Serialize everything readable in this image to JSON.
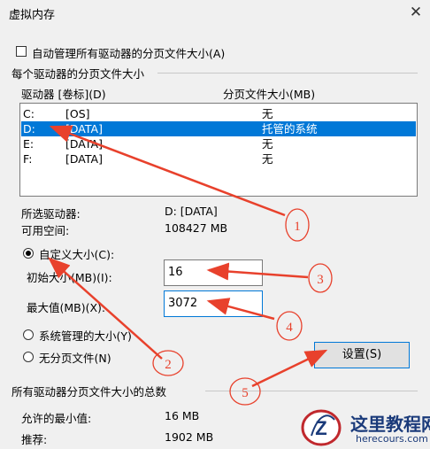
{
  "window": {
    "title": "虚拟内存",
    "close_glyph": "✕"
  },
  "auto_manage": {
    "label": "自动管理所有驱动器的分页文件大小(A)",
    "checked": false
  },
  "per_drive": {
    "group_label": "每个驱动器的分页文件大小",
    "col_drive": "驱动器 [卷标](D)",
    "col_size": "分页文件大小(MB)",
    "drives": [
      {
        "letter": "C:",
        "label": "[OS]",
        "size": "无",
        "selected": false
      },
      {
        "letter": "D:",
        "label": "[DATA]",
        "size": "托管的系统",
        "selected": true
      },
      {
        "letter": "E:",
        "label": "[DATA]",
        "size": "无",
        "selected": false
      },
      {
        "letter": "F:",
        "label": "[DATA]",
        "size": "无",
        "selected": false
      }
    ],
    "selected_drive_label": "所选驱动器:",
    "selected_drive_value": "D:  [DATA]",
    "free_space_label": "可用空间:",
    "free_space_value": "108427 MB"
  },
  "custom_size": {
    "label": "自定义大小(C):",
    "initial_label": "初始大小(MB)(I):",
    "initial_value": "16",
    "max_label": "最大值(MB)(X):",
    "max_value": "3072"
  },
  "system_managed_label": "系统管理的大小(Y)",
  "no_paging_label": "无分页文件(N)",
  "set_button": "设置(S)",
  "totals": {
    "group_label": "所有驱动器分页文件大小的总数",
    "min_label": "允许的最小值:",
    "min_value": "16 MB",
    "recommended_label": "推荐:",
    "recommended_value": "1902 MB"
  },
  "annotations": [
    "1",
    "2",
    "3",
    "4",
    "5"
  ],
  "annotation_color": "#e8412c",
  "watermark": {
    "cn": "这里教程网",
    "en": "herecours.com",
    "logo_letter": "Z"
  }
}
